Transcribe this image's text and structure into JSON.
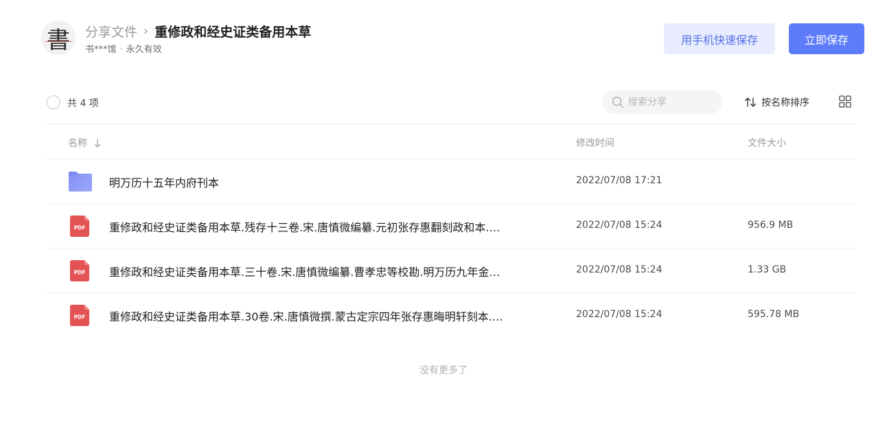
{
  "header": {
    "avatar_char": "書",
    "breadcrumb_root": "分享文件",
    "breadcrumb_sep": "›",
    "title": "重修政和经史证类备用本草",
    "sharer": "书***馆",
    "dot": "·",
    "validity": "永久有效",
    "phone_save_label": "用手机快速保存",
    "save_label": "立即保存"
  },
  "toolbar": {
    "count_label": "共 4 项",
    "search_placeholder": "搜索分享",
    "sort_label": "按名称排序"
  },
  "columns": {
    "name": "名称",
    "time": "修改时间",
    "size": "文件大小"
  },
  "files": [
    {
      "type": "folder",
      "name": "明万历十五年内府刊本",
      "time": "2022/07/08 17:21",
      "size": ""
    },
    {
      "type": "pdf",
      "name": "重修政和经史证类备用本草.残存十三卷.宋.唐慎微编纂.元初张存惠翻刻政和本.…",
      "time": "2022/07/08 15:24",
      "size": "956.9 MB"
    },
    {
      "type": "pdf",
      "name": "重修政和经史证类备用本草.三十卷.宋.唐慎微编纂.曹孝忠等校勘.明万历九年金…",
      "time": "2022/07/08 15:24",
      "size": "1.33 GB"
    },
    {
      "type": "pdf",
      "name": "重修政和经史证类备用本草.30卷.宋.唐慎微撰.蒙古定宗四年张存惠晦明轩刻本.…",
      "time": "2022/07/08 15:24",
      "size": "595.78 MB"
    }
  ],
  "footer": {
    "end_text": "没有更多了"
  },
  "pdf_icon_text": "PDF",
  "icons": {
    "search": "search-icon",
    "sort": "sort-icon",
    "grid": "grid-view-icon",
    "folder": "folder-icon",
    "pdf": "pdf-file-icon",
    "sort_arrow": "arrow-down-icon"
  },
  "colors": {
    "accent": "#5c7cfa",
    "accent_light": "#e8ecfe",
    "pdf_red": "#e45353",
    "folder_blue": "#7f8ef5"
  }
}
